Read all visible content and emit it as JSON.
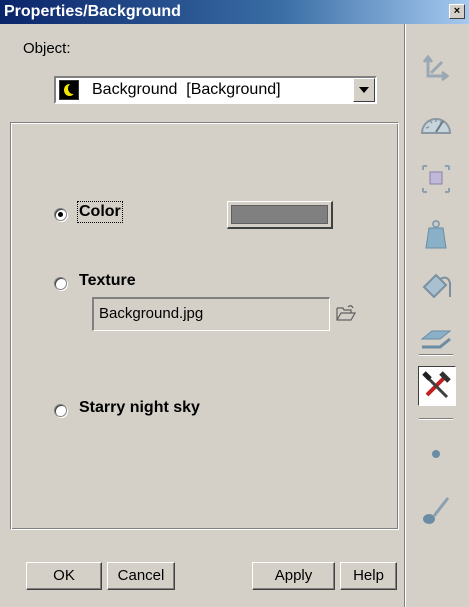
{
  "window": {
    "title": "Properties/Background",
    "close_glyph": "×"
  },
  "object": {
    "label": "Object:",
    "selected_value": "Background  [Background]",
    "icon": "night-moon-icon"
  },
  "background_options": {
    "color": {
      "label": "Color",
      "selected": true,
      "swatch_color": "#808080"
    },
    "texture": {
      "label": "Texture",
      "selected": false,
      "file_value": "Background.jpg",
      "browse_icon": "folder-open-icon"
    },
    "starry": {
      "label": "Starry night sky",
      "selected": false
    }
  },
  "buttons": {
    "ok": "OK",
    "cancel": "Cancel",
    "apply": "Apply",
    "help": "Help"
  },
  "toolbar": {
    "items": [
      {
        "name": "transform-axes-icon"
      },
      {
        "name": "gauge-icon"
      },
      {
        "name": "bounding-box-icon"
      },
      {
        "name": "weight-icon"
      },
      {
        "name": "paint-bucket-icon"
      },
      {
        "name": "layers-icon"
      },
      {
        "name": "tools-icon",
        "active": true
      },
      {
        "name": "point-icon"
      },
      {
        "name": "brush-icon"
      }
    ]
  },
  "colors": {
    "title_gradient_start": "#0a246a",
    "title_gradient_end": "#a6caf0",
    "face": "#d4d0c8"
  }
}
